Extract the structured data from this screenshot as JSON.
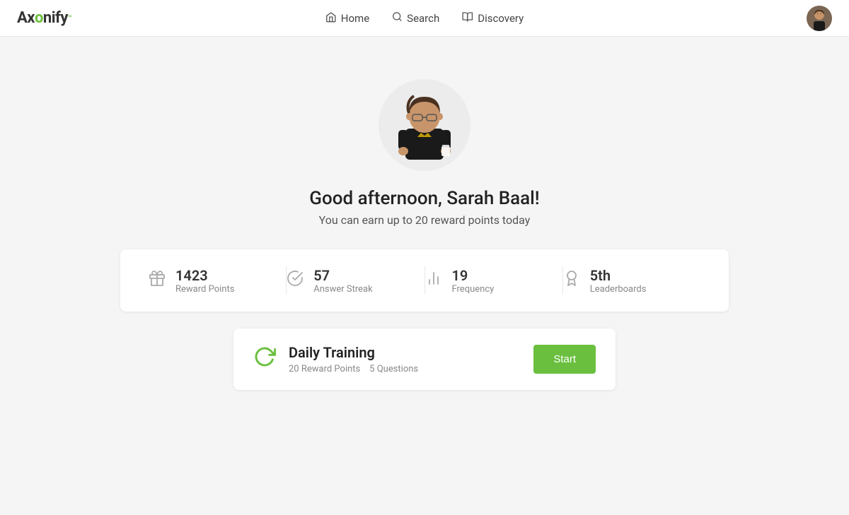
{
  "logo": {
    "text_ax": "Ax",
    "text_o": "o",
    "text_nify": "nify",
    "tm": "™"
  },
  "nav": {
    "home_label": "Home",
    "search_label": "Search",
    "discovery_label": "Discovery"
  },
  "greeting": {
    "title": "Good afternoon, Sarah Baal!",
    "subtitle": "You can earn up to 20 reward points today"
  },
  "stats": [
    {
      "value": "1423",
      "label": "Reward Points",
      "icon": "gift"
    },
    {
      "value": "57",
      "label": "Answer Streak",
      "icon": "check-circle"
    },
    {
      "value": "19",
      "label": "Frequency",
      "icon": "bar-chart"
    },
    {
      "value": "5th",
      "label": "Leaderboards",
      "icon": "ribbon"
    }
  ],
  "training": {
    "title": "Daily Training",
    "points": "20 Reward Points",
    "questions": "5 Questions",
    "start_label": "Start"
  }
}
